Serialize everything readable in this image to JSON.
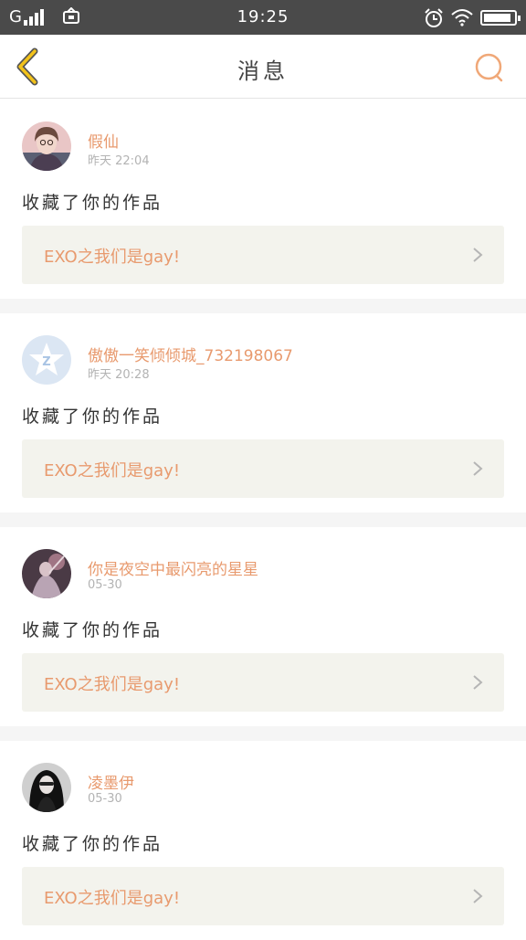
{
  "status_bar": {
    "carrier": "G",
    "time": "19:25",
    "battery_level": 0.9
  },
  "nav": {
    "title": "消息",
    "back_icon": "chevron-left-icon",
    "search_icon": "search-icon"
  },
  "colors": {
    "accent": "#e89a6e",
    "back_arrow": "#f2c21a",
    "card_bg": "#f3f3ed"
  },
  "messages": [
    {
      "user": "假仙",
      "time": "昨天 22:04",
      "action": "收藏了你的作品",
      "work_title": "EXO之我们是gay!"
    },
    {
      "user": "傲傲一笑倾倾城_732198067",
      "time": "昨天 20:28",
      "action": "收藏了你的作品",
      "work_title": "EXO之我们是gay!"
    },
    {
      "user": "你是夜空中最闪亮的星星",
      "time": "05-30",
      "action": "收藏了你的作品",
      "work_title": "EXO之我们是gay!"
    },
    {
      "user": "凌墨伊",
      "time": "05-30",
      "action": "收藏了你的作品",
      "work_title": "EXO之我们是gay!"
    }
  ]
}
